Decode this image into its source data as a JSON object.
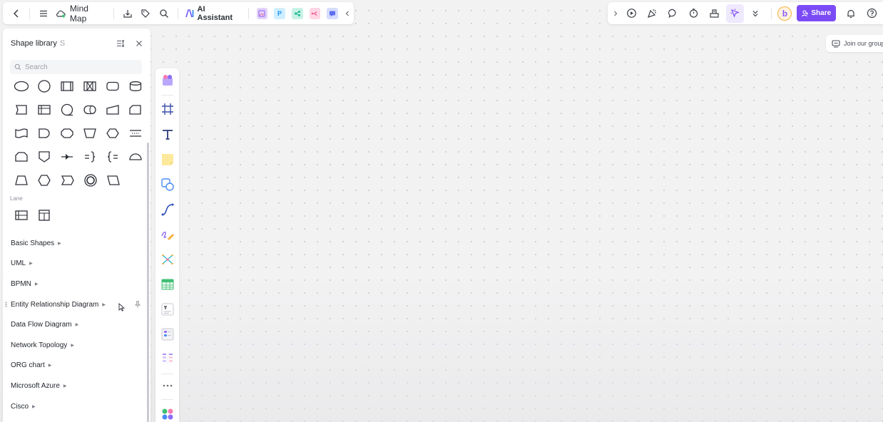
{
  "toolbar": {
    "doc_title": "Mind Map",
    "ai_assistant_label": "AI Assistant",
    "icons": [
      "back-icon",
      "menu-icon",
      "cloud-icon",
      "download-icon",
      "tag-icon",
      "search-icon"
    ],
    "apps": [
      {
        "name": "image-app-icon",
        "glyph": "",
        "color": "#d9c3f7"
      },
      {
        "name": "presentation-app-icon",
        "glyph": "P",
        "color": "#c9ecff"
      },
      {
        "name": "share-nodes-app-icon",
        "glyph": "",
        "color": "#c8f2e6"
      },
      {
        "name": "mindmap-app-icon",
        "glyph": "",
        "color": "#ffd3e4"
      },
      {
        "name": "chat-app-icon",
        "glyph": "",
        "color": "#d3dcff"
      }
    ]
  },
  "right_toolbar": {
    "share_label": "Share",
    "avatar_letter": "b",
    "accent": "#7b4cf6"
  },
  "join_group_label": "Join our group",
  "shape_library": {
    "title": "Shape library",
    "shortcut": "S",
    "search_placeholder": "Search",
    "lane_label": "Lane",
    "categories": [
      "Basic Shapes",
      "UML",
      "BPMN",
      "Entity Relationship Diagram",
      "Data Flow Diagram",
      "Network Topology",
      "ORG chart",
      "Microsoft Azure",
      "Cisco"
    ]
  }
}
